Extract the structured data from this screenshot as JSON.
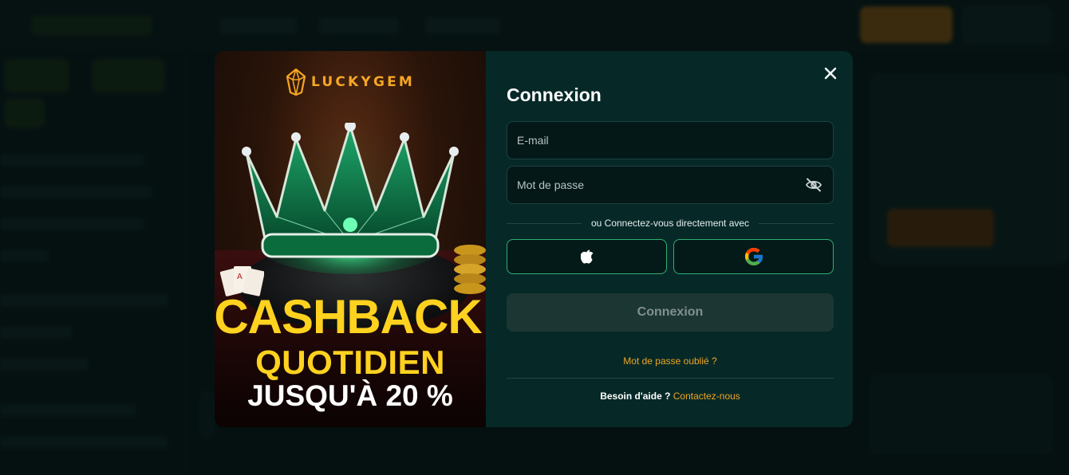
{
  "promo": {
    "brand": "LUCKYGEM",
    "headline_1": "CASHBACK",
    "headline_2": "QUOTIDIEN",
    "headline_3": "JUSQU'À 20 %",
    "accent_color": "#ffd21f",
    "brand_color": "#f5a623"
  },
  "login": {
    "title": "Connexion",
    "email_placeholder": "E-mail",
    "email_value": "",
    "password_placeholder": "Mot de passe",
    "password_value": "",
    "divider_text": "ou Connectez-vous directement avec",
    "social": [
      {
        "name": "apple",
        "icon": "apple-icon"
      },
      {
        "name": "google",
        "icon": "google-icon"
      }
    ],
    "submit_label": "Connexion",
    "forgot_label": "Mot de passe oublié ?",
    "help_label": "Besoin d'aide ?",
    "help_link": "Contactez-nous",
    "link_color": "#f0a523",
    "social_border_color": "#2fae74"
  }
}
